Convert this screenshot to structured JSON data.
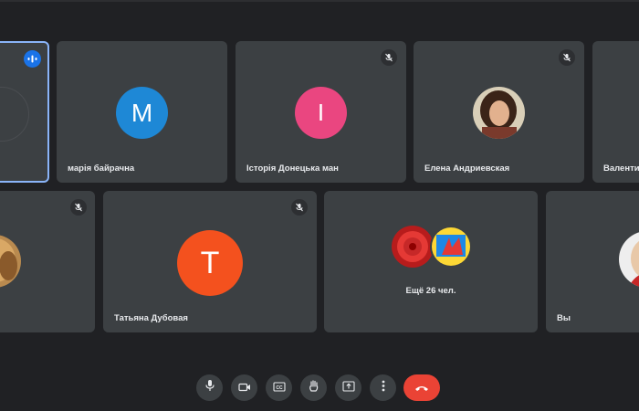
{
  "participants": [
    {
      "name": "",
      "muted": false,
      "speaking": true
    },
    {
      "name": "марія байрачна",
      "initial": "М",
      "avatar_color": "#1e88d6",
      "muted": false
    },
    {
      "name": "Історія Донецька ман",
      "initial": "І",
      "avatar_color": "#ea4680",
      "muted": true
    },
    {
      "name": "Елена Андриевская",
      "avatar": "photo",
      "muted": true
    },
    {
      "name": "Валентина",
      "muted": false
    },
    {
      "name": "",
      "avatar": "photo",
      "muted": true
    },
    {
      "name": "Татьяна Дубовая",
      "initial": "Т",
      "avatar_color": "#f4511e",
      "muted": true
    },
    {
      "name": "Вы",
      "avatar": "photo",
      "muted": false
    }
  ],
  "more": {
    "label": "Ещё 26 чел."
  },
  "controls": {
    "mic": "mic-icon",
    "camera": "videocam-icon",
    "captions": "closed-captions-icon",
    "hand": "raise-hand-icon",
    "present": "present-screen-icon",
    "more": "more-vert-icon",
    "end": "end-call-icon",
    "end_color": "#ea4335"
  }
}
